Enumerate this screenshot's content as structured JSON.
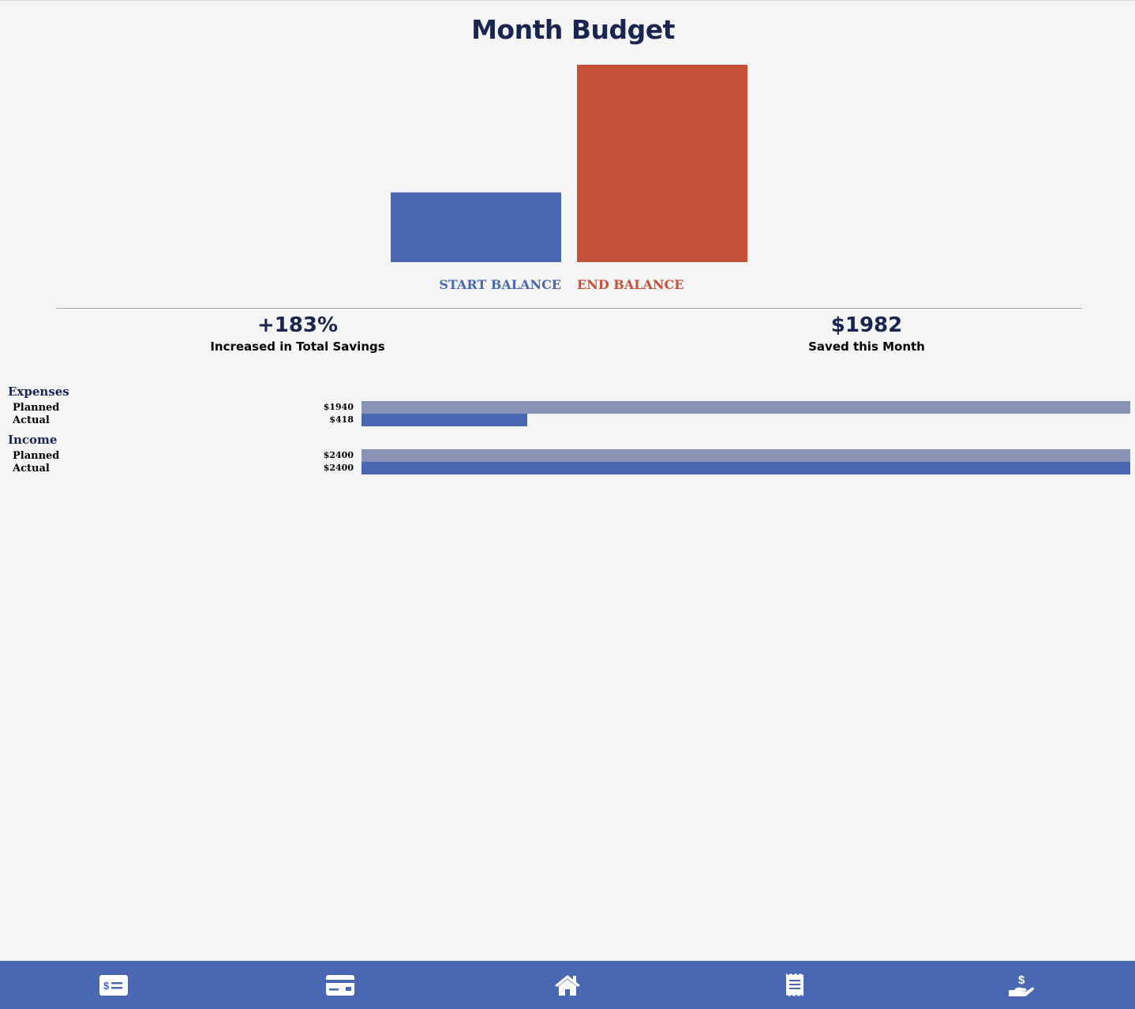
{
  "page": {
    "title": "Month Budget"
  },
  "chart_data": {
    "type": "bar",
    "categories": [
      "START BALANCE",
      "END BALANCE"
    ],
    "values": [
      1083,
      3065
    ],
    "colors": [
      "#4a67b2",
      "#c35037"
    ],
    "grid": false,
    "legend": "none"
  },
  "stats": {
    "savings_increase": {
      "value": "+183%",
      "label": "Increased in Total Savings"
    },
    "saved_month": {
      "value": "$1982",
      "label": "Saved this Month"
    }
  },
  "budget_bars": {
    "colors": {
      "planned": "#8794b5",
      "actual": "#4a67b2"
    },
    "groups": [
      {
        "title": "Expenses",
        "rows": [
          {
            "label": "Planned",
            "value_text": "$1940",
            "fraction": 1.0
          },
          {
            "label": "Actual",
            "value_text": "$418",
            "fraction": 0.2155
          }
        ]
      },
      {
        "title": "Income",
        "rows": [
          {
            "label": "Planned",
            "value_text": "$2400",
            "fraction": 1.0
          },
          {
            "label": "Actual",
            "value_text": "$2400",
            "fraction": 1.0
          }
        ]
      }
    ]
  },
  "tabbar": {
    "background": "#4a67b2",
    "tabs": [
      {
        "icon": "money-bill-icon"
      },
      {
        "icon": "credit-card-icon"
      },
      {
        "icon": "home-icon"
      },
      {
        "icon": "receipt-icon"
      },
      {
        "icon": "hand-holding-dollar-icon"
      }
    ]
  }
}
